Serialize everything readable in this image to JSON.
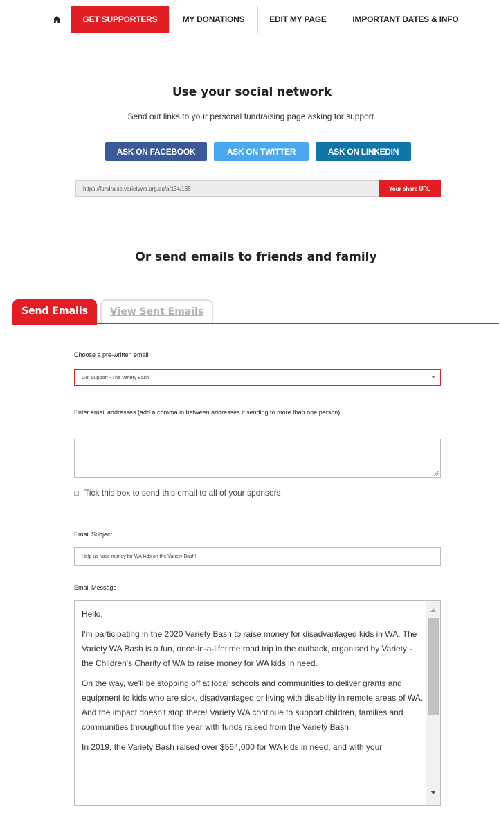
{
  "nav": {
    "home_icon": "home-icon",
    "items": [
      "GET SUPPORTERS",
      "MY DONATIONS",
      "EDIT MY PAGE",
      "IMPORTANT DATES & INFO"
    ],
    "active": "GET SUPPORTERS"
  },
  "social": {
    "title": "Use your social network",
    "subtitle": "Send out links to your personal fundraising page asking for support.",
    "facebook_label": "ASK ON FACEBOOK",
    "twitter_label": "ASK ON TWITTER",
    "linkedin_label": "ASK ON LINKEDIN",
    "share_url": "https://fundraise.varietywa.org.au/a/134/165",
    "share_url_label": "Your share URL"
  },
  "email_heading": "Or send emails to friends and family",
  "tabs": {
    "active": "Send Emails",
    "inactive": "View Sent Emails"
  },
  "form": {
    "template_label": "Choose a pre-written email",
    "template_value": "Get Support - The Variety Bash",
    "addresses_label": "Enter email addresses (add a comma in between addresses if sending to more than one person)",
    "sponsors_checkbox_label": "Tick this box to send this email to all of your sponsors",
    "subject_label": "Email Subject",
    "subject_value": "Help us raise money for WA kids on the Variety Bash!",
    "message_label": "Email Message",
    "message_paragraphs": [
      "Hello,",
      "I'm participating in the 2020 Variety Bash to raise money for disadvantaged kids in WA. The Variety WA Bash is a fun, once-in-a-lifetime road trip in the outback, organised by Variety - the Children's Charity of WA to raise money for WA kids in need.",
      "On the way, we'll be stopping off at local schools and communities to deliver grants and equipment to kids who are sick, disadvantaged or living with disability in remote areas of WA. And the impact doesn't stop there! Variety WA continue to support children, families and communities throughout the year with funds raised from the Variety Bash.",
      "In 2019, the Variety Bash raised over $564,000 for WA kids in need, and with your"
    ]
  },
  "colors": {
    "brand_red": "#e31d24",
    "facebook": "#3b5998",
    "twitter": "#4aa8f0",
    "linkedin": "#0e76a8"
  }
}
